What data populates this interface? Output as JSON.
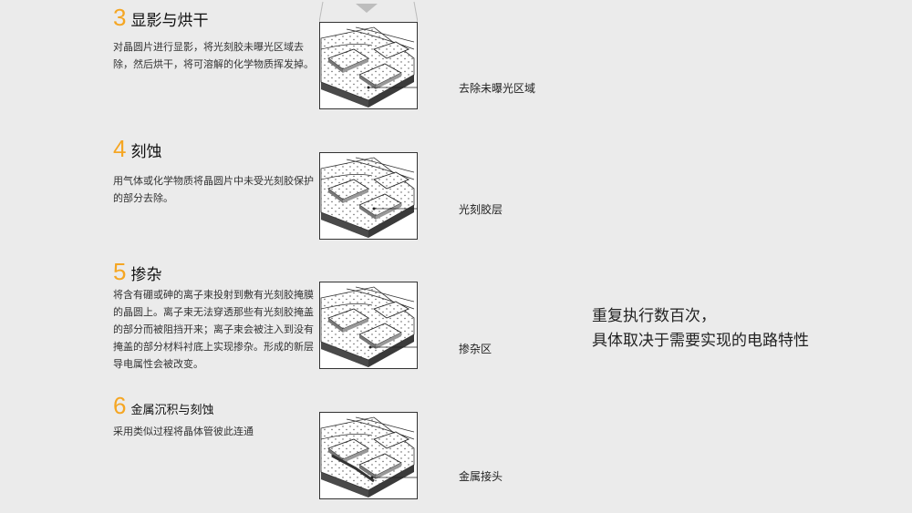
{
  "steps": [
    {
      "number": "3",
      "title": "显影与烘干",
      "description": "对晶圆片进行显影，将光刻胶未曝光区域去除，然后烘干，将可溶解的化学物质挥发掉。",
      "callout": "去除未曝光区域"
    },
    {
      "number": "4",
      "title": "刻蚀",
      "description": "用气体或化学物质将晶圆片中未受光刻胶保护的部分去除。",
      "callout": "光刻胶层"
    },
    {
      "number": "5",
      "title": "掺杂",
      "description": "将含有硼或砷的离子束投射到敷有光刻胶掩膜的晶圆上。离子束无法穿透那些有光刻胶掩盖的部分而被阻挡开来；离子束会被注入到没有掩盖的部分材料衬底上实现掺杂。形成的新层导电属性会被改变。",
      "callout": "掺杂区"
    },
    {
      "number": "6",
      "title": "金属沉积与刻蚀",
      "description": "采用类似过程将晶体管彼此连通",
      "callout": "金属接头"
    }
  ],
  "summary": {
    "line1": "重复执行数百次，",
    "line2": "具体取决于需要实现的电路特性"
  },
  "colors": {
    "accent": "#f5a623",
    "background": "#ebebeb"
  }
}
